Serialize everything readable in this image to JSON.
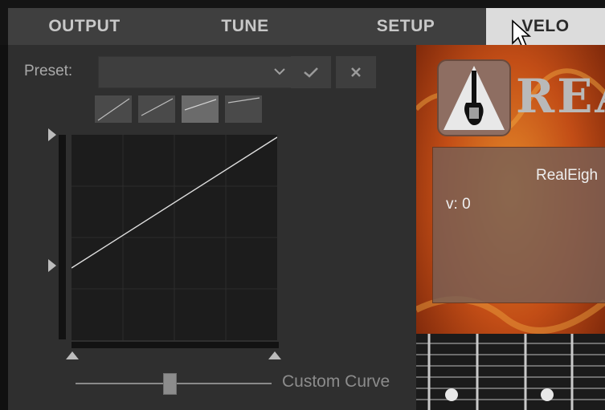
{
  "tabs": [
    "OUTPUT",
    "TUNE",
    "SETUP",
    "VELO"
  ],
  "active_tab": "VELO",
  "preset": {
    "label": "Preset:",
    "value": "",
    "confirm_icon": "check-icon",
    "cancel_icon": "close-icon"
  },
  "curve_presets": [
    "linear",
    "concave-1",
    "concave-2",
    "concave-3"
  ],
  "selected_curve_preset": 2,
  "velocity_curve": {
    "in_min": 0,
    "in_max": 127,
    "out_min": 0.25,
    "out_max": 1.0
  },
  "curve_slider": {
    "label": "Custom Curve",
    "value": 0.48
  },
  "instrument": {
    "brand": "REA",
    "name": "RealEigh",
    "velocity_label": "v:",
    "velocity_value": "0"
  },
  "colors": {
    "tab_active": "#dcdcdc",
    "panel": "#2f2f2f",
    "graph": "#1c1c1c",
    "curve": "#dedede"
  }
}
